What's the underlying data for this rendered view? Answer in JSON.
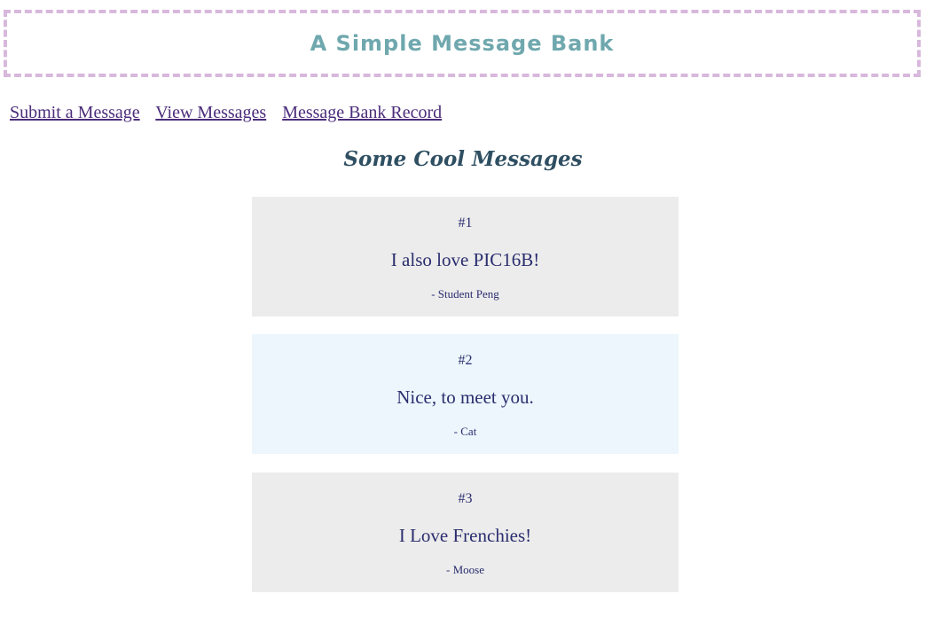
{
  "header": {
    "title": "A Simple Message Bank"
  },
  "nav": {
    "links": [
      {
        "label": "Submit a Message"
      },
      {
        "label": "View Messages"
      },
      {
        "label": "Message Bank Record"
      }
    ]
  },
  "main": {
    "section_title": "Some Cool Messages",
    "messages": [
      {
        "number": "#1",
        "text": "I also love PIC16B!",
        "author": "- Student Peng",
        "background": "#ececec"
      },
      {
        "number": "#2",
        "text": "Nice, to meet you.",
        "author": "- Cat",
        "background": "#ecf6fc"
      },
      {
        "number": "#3",
        "text": "I Love Frenchies!",
        "author": "- Moose",
        "background": "#ececec"
      }
    ]
  },
  "colors": {
    "header_border": "#d8b8dc",
    "title": "#6fa8ae",
    "link": "#4b2c7a",
    "section_title": "#2f4f62",
    "message_text": "#2a2d6e"
  }
}
